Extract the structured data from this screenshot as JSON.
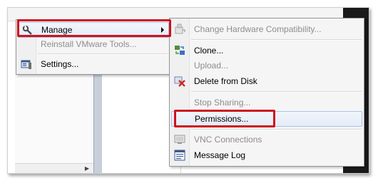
{
  "left_menu": {
    "items": [
      {
        "label": "Manage",
        "icon": "wrench-icon",
        "submenu": true,
        "enabled": true
      },
      {
        "label": "Reinstall VMware Tools...",
        "icon": "",
        "enabled": false
      },
      {
        "label": "Settings...",
        "icon": "settings-icon",
        "enabled": true
      }
    ]
  },
  "manage_menu": {
    "items": [
      {
        "label": "Change Hardware Compatibility...",
        "icon": "hardware-upgrade-icon",
        "enabled": false
      },
      {
        "label": "Clone...",
        "icon": "clone-icon",
        "enabled": true
      },
      {
        "label": "Upload...",
        "icon": "",
        "enabled": false
      },
      {
        "label": "Delete from Disk",
        "icon": "delete-icon",
        "enabled": true
      },
      {
        "label": "Stop Sharing...",
        "icon": "",
        "enabled": false
      },
      {
        "label": "Permissions...",
        "icon": "",
        "enabled": true
      },
      {
        "label": "VNC Connections",
        "icon": "monitor-icon",
        "enabled": false
      },
      {
        "label": "Message Log",
        "icon": "log-icon",
        "enabled": true
      }
    ]
  },
  "colors": {
    "highlight_border": "#d0121b",
    "menu_background": "#f5f5f5",
    "disabled_text": "#8d8d8d"
  }
}
